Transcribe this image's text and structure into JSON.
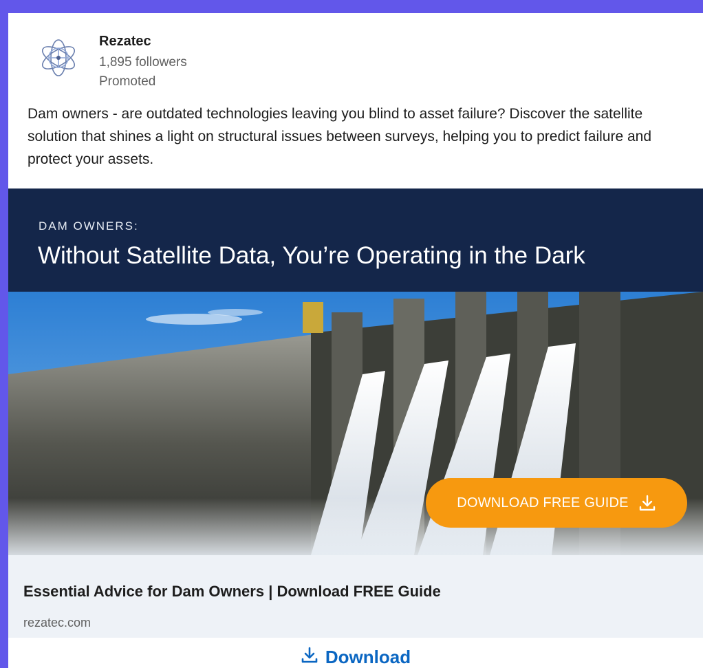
{
  "post": {
    "company": "Rezatec",
    "followers": "1,895 followers",
    "promoted": "Promoted",
    "body": "Dam owners - are outdated technologies leaving you blind to asset failure? Discover the satellite solution that shines a light on structural issues between surveys, helping you to predict failure and protect your assets."
  },
  "creative": {
    "eyebrow": "DAM OWNERS:",
    "headline": "Without Satellite Data, You’re Operating in the Dark",
    "cta_label": "DOWNLOAD FREE GUIDE",
    "cta_icon": "download-icon"
  },
  "link": {
    "title": "Essential Advice for Dam Owners | Download FREE Guide",
    "domain": "rezatec.com"
  },
  "action": {
    "label": "Download",
    "icon": "download-icon"
  },
  "colors": {
    "page_background": "#6257ea",
    "banner": "#14264a",
    "cta": "#f7990f",
    "link_bar": "#eef2f7",
    "action": "#0a66c2"
  }
}
